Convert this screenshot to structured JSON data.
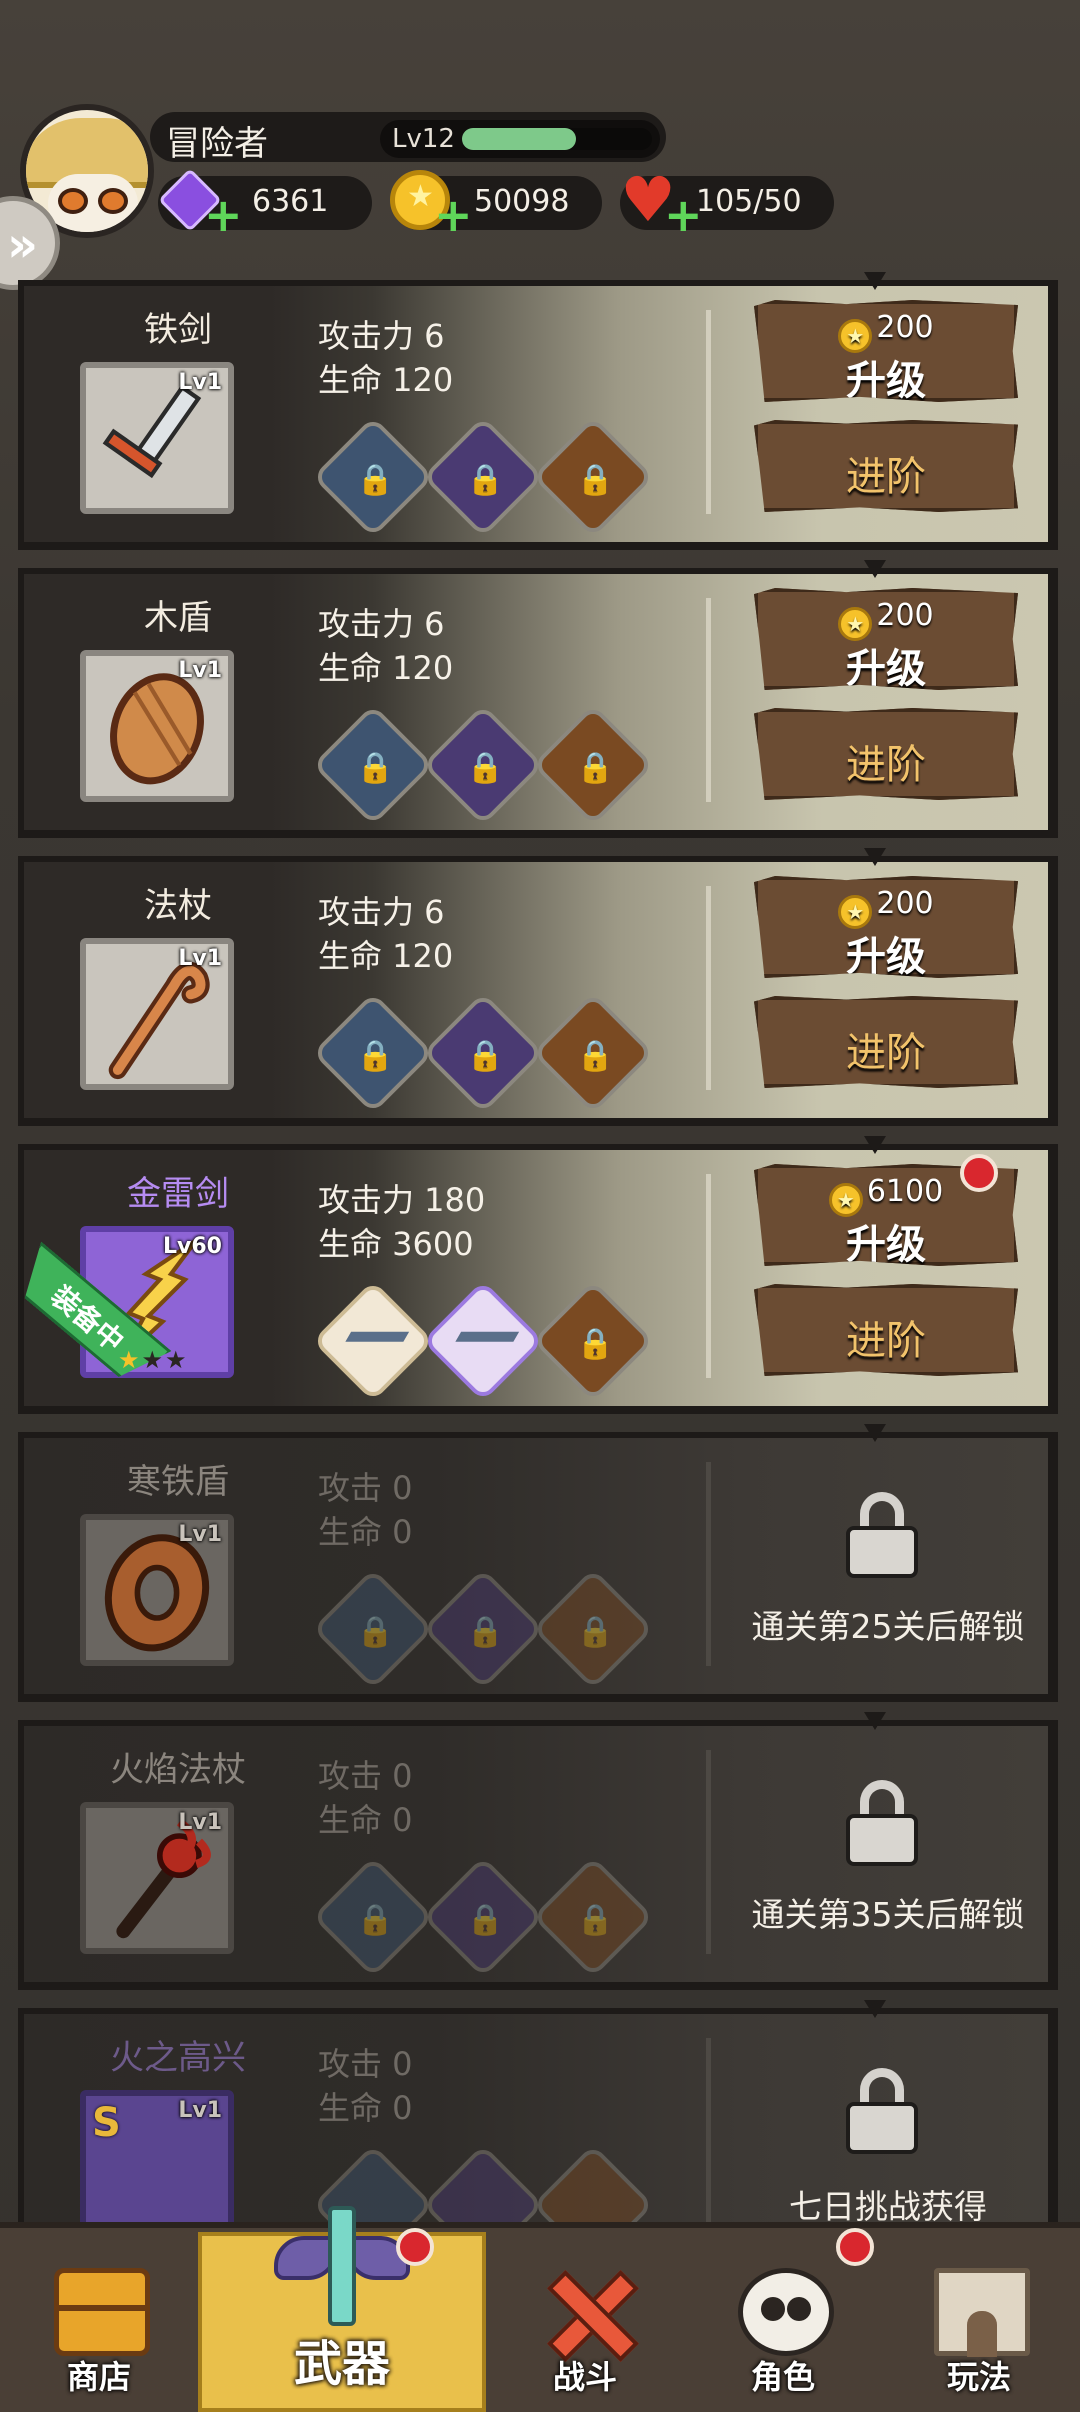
{
  "player": {
    "name": "冒险者",
    "level_label": "Lv12",
    "exp_fraction": 0.6,
    "gems": "6361",
    "coins": "50098",
    "stamina": "105/50"
  },
  "weapons": [
    {
      "name": "铁剑",
      "level": "Lv1",
      "attack_label": "攻击力 6",
      "hp_label": "生命 120",
      "cost": "200",
      "upgrade": "升级",
      "advance": "进阶",
      "locked": false
    },
    {
      "name": "木盾",
      "level": "Lv1",
      "attack_label": "攻击力 6",
      "hp_label": "生命 120",
      "cost": "200",
      "upgrade": "升级",
      "advance": "进阶",
      "locked": false
    },
    {
      "name": "法杖",
      "level": "Lv1",
      "attack_label": "攻击力 6",
      "hp_label": "生命 120",
      "cost": "200",
      "upgrade": "升级",
      "advance": "进阶",
      "locked": false
    },
    {
      "name": "金雷剑",
      "level": "Lv60",
      "attack_label": "攻击力 180",
      "hp_label": "生命 3600",
      "cost": "6100",
      "upgrade": "升级",
      "advance": "进阶",
      "locked": false,
      "equipped_label": "装备中",
      "stars": 1
    },
    {
      "name": "寒铁盾",
      "level": "Lv1",
      "attack_label": "攻击 0",
      "hp_label": "生命 0",
      "unlock_text": "通关第25关后解锁",
      "locked": true
    },
    {
      "name": "火焰法杖",
      "level": "Lv1",
      "attack_label": "攻击 0",
      "hp_label": "生命 0",
      "unlock_text": "通关第35关后解锁",
      "locked": true
    },
    {
      "name": "火之高兴",
      "level": "Lv1",
      "attack_label": "攻击 0",
      "hp_label": "生命 0",
      "unlock_text": "七日挑战获得",
      "locked": true
    }
  ],
  "nav": {
    "shop": "商店",
    "weapons": "武器",
    "battle": "战斗",
    "character": "角色",
    "gameplay": "玩法"
  },
  "colors": {
    "accent": "#e9c04b",
    "notify": "#d9272e",
    "exp": "#7ec98a"
  }
}
